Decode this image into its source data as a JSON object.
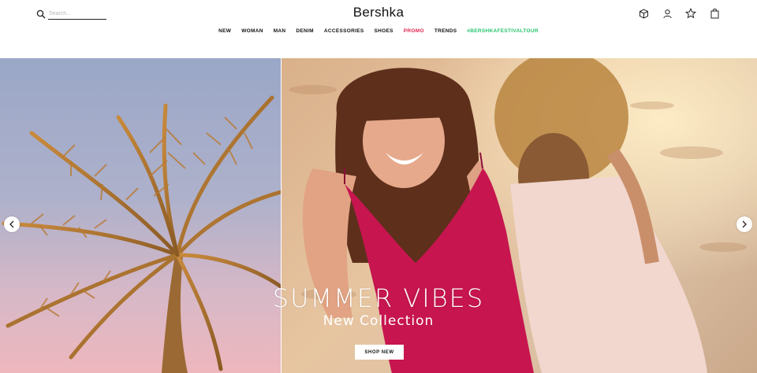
{
  "header": {
    "search": {
      "placeholder": "Search..."
    },
    "brand": "Bershka",
    "icons": [
      "store-locator-icon",
      "user-icon",
      "wishlist-star-icon",
      "shopping-bag-icon"
    ]
  },
  "nav": {
    "items": [
      {
        "label": "NEW"
      },
      {
        "label": "WOMAN"
      },
      {
        "label": "MAN"
      },
      {
        "label": "DENIM"
      },
      {
        "label": "ACCESSORIES"
      },
      {
        "label": "SHOES"
      },
      {
        "label": "PROMO",
        "color": "#e2244f"
      },
      {
        "label": "TRENDS"
      },
      {
        "label": "#BERSHKAFESTIVALTOUR",
        "color": "#27c46d"
      }
    ]
  },
  "hero": {
    "title": "SUMMER VIBES",
    "subtitle": "New Collection",
    "cta": "SHOP NEW"
  }
}
